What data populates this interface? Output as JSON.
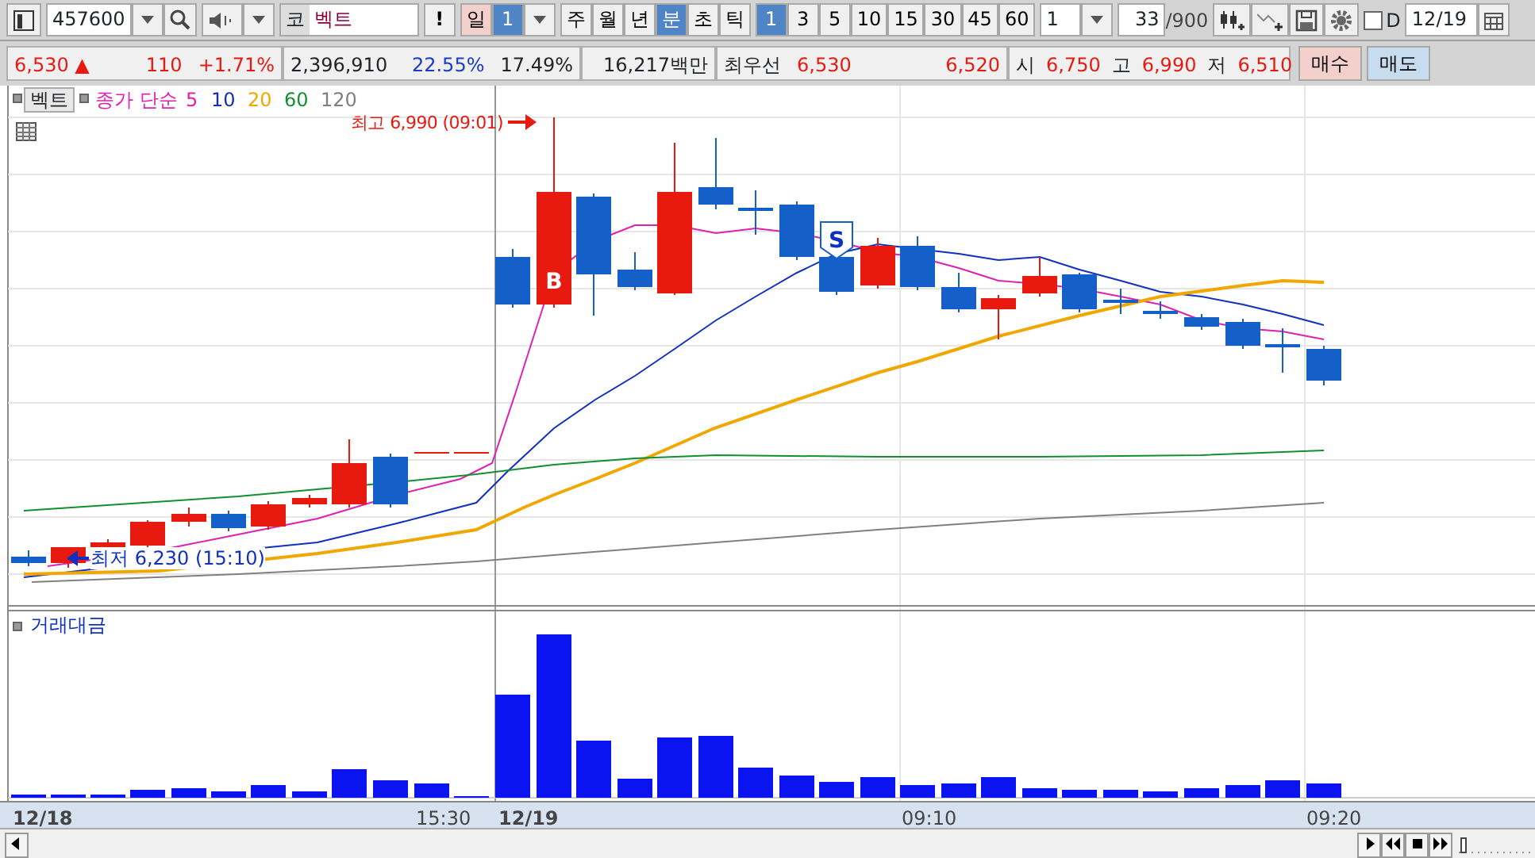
{
  "toolbar": {
    "code": "457600",
    "market": "코",
    "name": "벡트",
    "alert": "!",
    "periods": [
      {
        "label": "일",
        "selected": false,
        "kind": "pink"
      },
      {
        "label": "1",
        "selected": true,
        "kind": "num"
      }
    ],
    "units": [
      {
        "label": "주",
        "selected": false
      },
      {
        "label": "월",
        "selected": false
      },
      {
        "label": "년",
        "selected": false
      },
      {
        "label": "분",
        "selected": true
      },
      {
        "label": "초",
        "selected": false
      },
      {
        "label": "틱",
        "selected": false
      }
    ],
    "intervals": [
      {
        "label": "1",
        "selected": true
      },
      {
        "label": "3",
        "selected": false
      },
      {
        "label": "5",
        "selected": false
      },
      {
        "label": "10",
        "selected": false
      },
      {
        "label": "15",
        "selected": false
      },
      {
        "label": "30",
        "selected": false
      },
      {
        "label": "45",
        "selected": false
      },
      {
        "label": "60",
        "selected": false
      }
    ],
    "combo": "1",
    "count": "33",
    "total": "/900",
    "d_checkbox": {
      "label": "D",
      "checked": false
    },
    "date": "12/19"
  },
  "quote": {
    "price": "6,530",
    "arrow": "▲",
    "change": "110",
    "change_pct": "+1.71%",
    "volume": "2,396,910",
    "ratio_1": "22.55%",
    "ratio_2": "17.49%",
    "amount": "16,217백만",
    "best_label": "최우선",
    "ask": "6,530",
    "bid": "6,520",
    "ohl": [
      {
        "label": "시",
        "value": "6,750"
      },
      {
        "label": "고",
        "value": "6,990"
      },
      {
        "label": "저",
        "value": "6,510"
      }
    ],
    "buy": "매수",
    "sell": "매도"
  },
  "chart": {
    "name_tag": "벡트",
    "ma_label": "종가 단순",
    "moving_averages": [
      {
        "period": "5",
        "color": "#e020b0"
      },
      {
        "period": "10",
        "color": "#1030c0"
      },
      {
        "period": "20",
        "color": "#f0a800"
      },
      {
        "period": "60",
        "color": "#109030"
      },
      {
        "period": "120",
        "color": "#808080"
      }
    ],
    "high_label": "최고 6,990 (09:01)",
    "low_label": "최저 6,230 (15:10)",
    "signals": [
      {
        "kind": "buy",
        "text": "B"
      },
      {
        "kind": "sell",
        "text": "S"
      }
    ],
    "volume_title": "거래대금",
    "x_labels": [
      {
        "text": "12/18",
        "bold": true
      },
      {
        "text": "15:30",
        "bold": false
      },
      {
        "text": "12/19",
        "bold": true
      },
      {
        "text": "09:10",
        "bold": false
      },
      {
        "text": "09:20",
        "bold": false
      }
    ]
  },
  "zoom_slider": {
    "level": 0.02
  }
}
